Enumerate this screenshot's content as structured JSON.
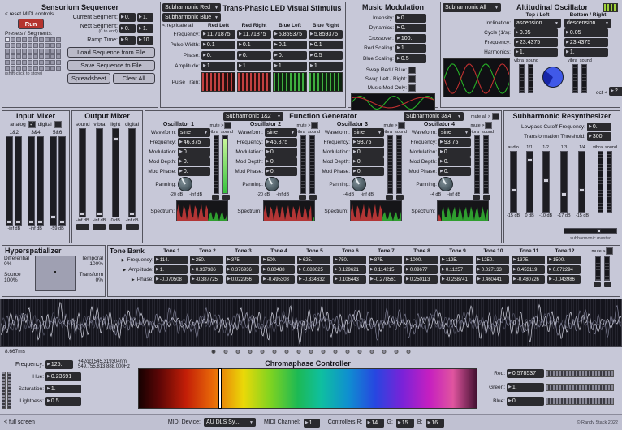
{
  "colors": {
    "bg": "#c7c8d8",
    "panel_border": "#54545e",
    "box_bg": "#2a2a2e",
    "accent_red": "#b5342e",
    "green": "#35c23c",
    "scope_bg": "#14141c"
  },
  "sequencer": {
    "title": "Sensorium Sequencer",
    "reset_label": "< reset MIDI controls",
    "run_label": "Run",
    "presets_label": "Presets / Segments:",
    "store_hint": "(shift-click to store)",
    "rows": [
      {
        "label": "Current Segment:",
        "hint": "",
        "values": [
          "0.",
          "1."
        ]
      },
      {
        "label": "Next Segment:",
        "hint": "(0 to end)",
        "values": [
          "0.",
          "1."
        ]
      },
      {
        "label": "Ramp Time:",
        "hint": "",
        "values": [
          "9.",
          "10."
        ]
      }
    ],
    "file_buttons": [
      "Load Sequence from File",
      "Save Sequence to File"
    ],
    "small_buttons": [
      "Spreadsheet",
      "Clear All"
    ]
  },
  "led": {
    "title": "Trans-Phasic LED Visual Stimulus",
    "dropdowns": [
      "Subharmonic Red",
      "Subharmonic Blue"
    ],
    "replicate_label": "< replicate all",
    "columns": [
      "Red Left",
      "Red Right",
      "Blue Left",
      "Blue Right"
    ],
    "rows": [
      {
        "label": "Frequency:",
        "values": [
          "11.71875",
          "11.71875",
          "5.859375",
          "5.859375"
        ]
      },
      {
        "label": "Pulse Width:",
        "values": [
          "0.1",
          "0.1",
          "0.1",
          "0.1"
        ]
      },
      {
        "label": "Phase:",
        "values": [
          "0.",
          "0.",
          "0.",
          "0.5"
        ]
      },
      {
        "label": "Amplitude:",
        "values": [
          "1.",
          "1.",
          "1.",
          "1."
        ]
      }
    ],
    "pulse_label": "Pulse Train:",
    "strip_colors": [
      "red",
      "red",
      "green",
      "green"
    ]
  },
  "musicmod": {
    "title": "Music Modulation",
    "fields": [
      {
        "label": "Intensity:",
        "value": "0."
      },
      {
        "label": "Dynamics:",
        "value": "0."
      },
      {
        "label": "Crossover:",
        "value": "100."
      },
      {
        "label": "Red Scaling:",
        "value": "1."
      },
      {
        "label": "Blue Scaling:",
        "value": "0.5"
      }
    ],
    "checks": [
      "Swap Red / Blue:",
      "Swap Left / Right:",
      "Music Mod Only:"
    ]
  },
  "alt_osc": {
    "title": "Altitudinal Oscillator",
    "dropdown": "Subharmonic All",
    "col_left": "Top / Left",
    "col_right": "Bottom / Right",
    "rows": [
      {
        "label": "Inclination:",
        "type": "menu",
        "values": [
          "ascension",
          "descension"
        ]
      },
      {
        "label": "Cycle (1/s):",
        "type": "num",
        "values": [
          "0.05",
          "0.05"
        ]
      },
      {
        "label": "Frequency:",
        "type": "num",
        "values": [
          "23.4375",
          "23.4375"
        ]
      },
      {
        "label": "Harmonics:",
        "type": "num",
        "values": [
          "1.",
          "1."
        ]
      }
    ],
    "meter_labels": [
      "vibra",
      "sound"
    ],
    "oct_label": "oct <",
    "oct_value": "2."
  },
  "input_mixer": {
    "title": "Input Mixer",
    "mode_labels": [
      "analog",
      "digital"
    ],
    "groups": [
      "1&2",
      "3&4",
      "5&6"
    ],
    "db": [
      "-inf dB",
      "-inf dB",
      "-59 dB"
    ]
  },
  "output_mixer": {
    "title": "Output Mixer",
    "columns": [
      "sound",
      "vibra",
      "light",
      "digital"
    ],
    "db": [
      "-inf dB",
      "-inf dB",
      "0 dB",
      "-inf dB"
    ]
  },
  "funcgen": {
    "title": "Function Generator",
    "dropdowns": [
      "Subharmonic 1&2",
      "Subharmonic 3&4"
    ],
    "mute_label": "mute >",
    "mute_all_label": "mute all >",
    "row_labels": [
      "Waveform:",
      "Frequency:",
      "Modulation:",
      "Mod Depth:",
      "Mod Phase:",
      "Panning:",
      "Spectrum:"
    ],
    "meter_labels": [
      "vibra",
      "sound"
    ],
    "oscillators": [
      {
        "name": "Oscillator 1",
        "waveform": "sine",
        "frequency": "46.875",
        "modulation": "0.",
        "mod_depth": "0.",
        "mod_phase": "0.",
        "db": [
          "-20 dB",
          "-inf dB"
        ],
        "spectrum": "red-green"
      },
      {
        "name": "Oscillator 2",
        "waveform": "sine",
        "frequency": "46.875",
        "modulation": "0.",
        "mod_depth": "0.",
        "mod_phase": "0.",
        "db": [
          "-20 dB",
          "-inf dB"
        ],
        "spectrum": "red"
      },
      {
        "name": "Oscillator 3",
        "waveform": "sine",
        "frequency": "93.75",
        "modulation": "0.",
        "mod_depth": "0.",
        "mod_phase": "0.",
        "db": [
          "-4 dB",
          "-inf dB"
        ],
        "spectrum": "red-green"
      },
      {
        "name": "Oscillator 4",
        "waveform": "sine",
        "frequency": "93.75",
        "modulation": "0.",
        "mod_depth": "0.",
        "mod_phase": "0.",
        "db": [
          "-4 dB",
          "-inf dB"
        ],
        "spectrum": "green"
      }
    ]
  },
  "resynth": {
    "title": "Subharmonic Resynthesizer",
    "fields": [
      {
        "label": "Lowpass Cutoff Frequency:",
        "value": "0."
      },
      {
        "label": "Transformation Threshold:",
        "value": "300."
      }
    ],
    "fader_labels": [
      "audio",
      "1/1",
      "1/2",
      "1/3",
      "1/4"
    ],
    "db": [
      "-15 dB",
      "0 dB",
      "-10 dB",
      "-17 dB",
      "-15 dB"
    ],
    "meter_labels": [
      "vibra",
      "sound"
    ],
    "master_label": "subharmonic master"
  },
  "hyper": {
    "title": "Hyperspatializer",
    "labels": [
      {
        "name": "Differential",
        "value": "0%"
      },
      {
        "name": "Temporal",
        "value": "100%"
      },
      {
        "name": "Source",
        "value": "100%"
      },
      {
        "name": "Transform",
        "value": "0%"
      }
    ]
  },
  "tonebank": {
    "title": "Tone Bank",
    "row_labels": [
      "Frequency:",
      "Amplitude:",
      "Phase:"
    ],
    "mute_label": "mute >",
    "meter_labels": [
      "vibra",
      "sound"
    ],
    "tones": [
      {
        "name": "Tone 1",
        "freq": "114.",
        "amp": "1.",
        "phase": "-0.070508"
      },
      {
        "name": "Tone 2",
        "freq": "250.",
        "amp": "0.337386",
        "phase": "-0.387725"
      },
      {
        "name": "Tone 3",
        "freq": "375.",
        "amp": "0.376936",
        "phase": "0.022956"
      },
      {
        "name": "Tone 4",
        "freq": "500.",
        "amp": "0.80488",
        "phase": "-0.495308"
      },
      {
        "name": "Tone 5",
        "freq": "625.",
        "amp": "0.083625",
        "phase": "-0.334632"
      },
      {
        "name": "Tone 6",
        "freq": "750.",
        "amp": "0.129621",
        "phase": "0.106443"
      },
      {
        "name": "Tone 7",
        "freq": "875.",
        "amp": "0.114215",
        "phase": "-0.278561"
      },
      {
        "name": "Tone 8",
        "freq": "1000.",
        "amp": "0.09677",
        "phase": "0.250113"
      },
      {
        "name": "Tone 9",
        "freq": "1125.",
        "amp": "0.11257",
        "phase": "-0.258741"
      },
      {
        "name": "Tone 10",
        "freq": "1250.",
        "amp": "0.027133",
        "phase": "0.460441"
      },
      {
        "name": "Tone 11",
        "freq": "1375.",
        "amp": "0.453119",
        "phase": "-0.480726"
      },
      {
        "name": "Tone 12",
        "freq": "1500.",
        "amp": "0.072294",
        "phase": "-0.043986"
      }
    ]
  },
  "scope": {
    "time_label": "8.667ms",
    "dot_count": 17
  },
  "chroma": {
    "title": "Chromaphase Controller",
    "frequency_label": "Frequency:",
    "frequency_value": "125.",
    "wavelength_line1": "+42oct  545.319304nm",
    "wavelength_line2": "549,755,813,888,000Hz",
    "hsl": [
      {
        "label": "Hue:",
        "value": "0.23691"
      },
      {
        "label": "Saturation:",
        "value": "1."
      },
      {
        "label": "Lightness:",
        "value": "0.5"
      }
    ],
    "rgb": [
      {
        "label": "Red:",
        "value": "0.578537"
      },
      {
        "label": "Green:",
        "value": "1."
      },
      {
        "label": "Blue:",
        "value": "0."
      }
    ]
  },
  "bottombar": {
    "fullscreen_label": "< full screen",
    "midi_device_label": "MIDI Device:",
    "midi_device_value": "AU DLS Sy...",
    "midi_channel_label": "MIDI Channel:",
    "midi_channel_value": "1.",
    "controllers_label": "Controllers R:",
    "g_label": "G:",
    "b_label": "B:",
    "r_value": "14",
    "g_value": "15",
    "b_value": "16",
    "credit": "© Randy Stack 2022"
  }
}
